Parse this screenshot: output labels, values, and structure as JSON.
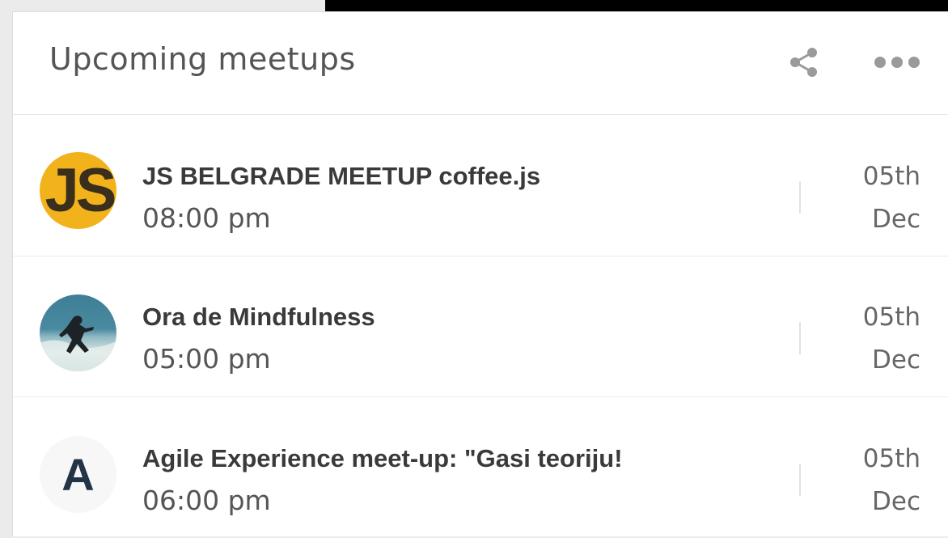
{
  "widget": {
    "title": "Upcoming meetups",
    "icons": {
      "share": "share-icon",
      "more": "more-horizontal-icon"
    }
  },
  "events": [
    {
      "avatar_text": "JS",
      "avatar_color": "#f2b21b",
      "title": "JS BELGRADE MEETUP coffee.js",
      "time": "08:00 pm",
      "day": "05th",
      "month": "Dec"
    },
    {
      "avatar_text": "",
      "avatar_image": "surfer-photo",
      "title": "Ora de Mindfulness",
      "time": "05:00 pm",
      "day": "05th",
      "month": "Dec"
    },
    {
      "avatar_text": "A",
      "avatar_color": "#f7f7f7",
      "title": "Agile Experience meet-up: \"Gasi teoriju!",
      "time": "06:00 pm",
      "day": "05th",
      "month": "Dec"
    }
  ]
}
